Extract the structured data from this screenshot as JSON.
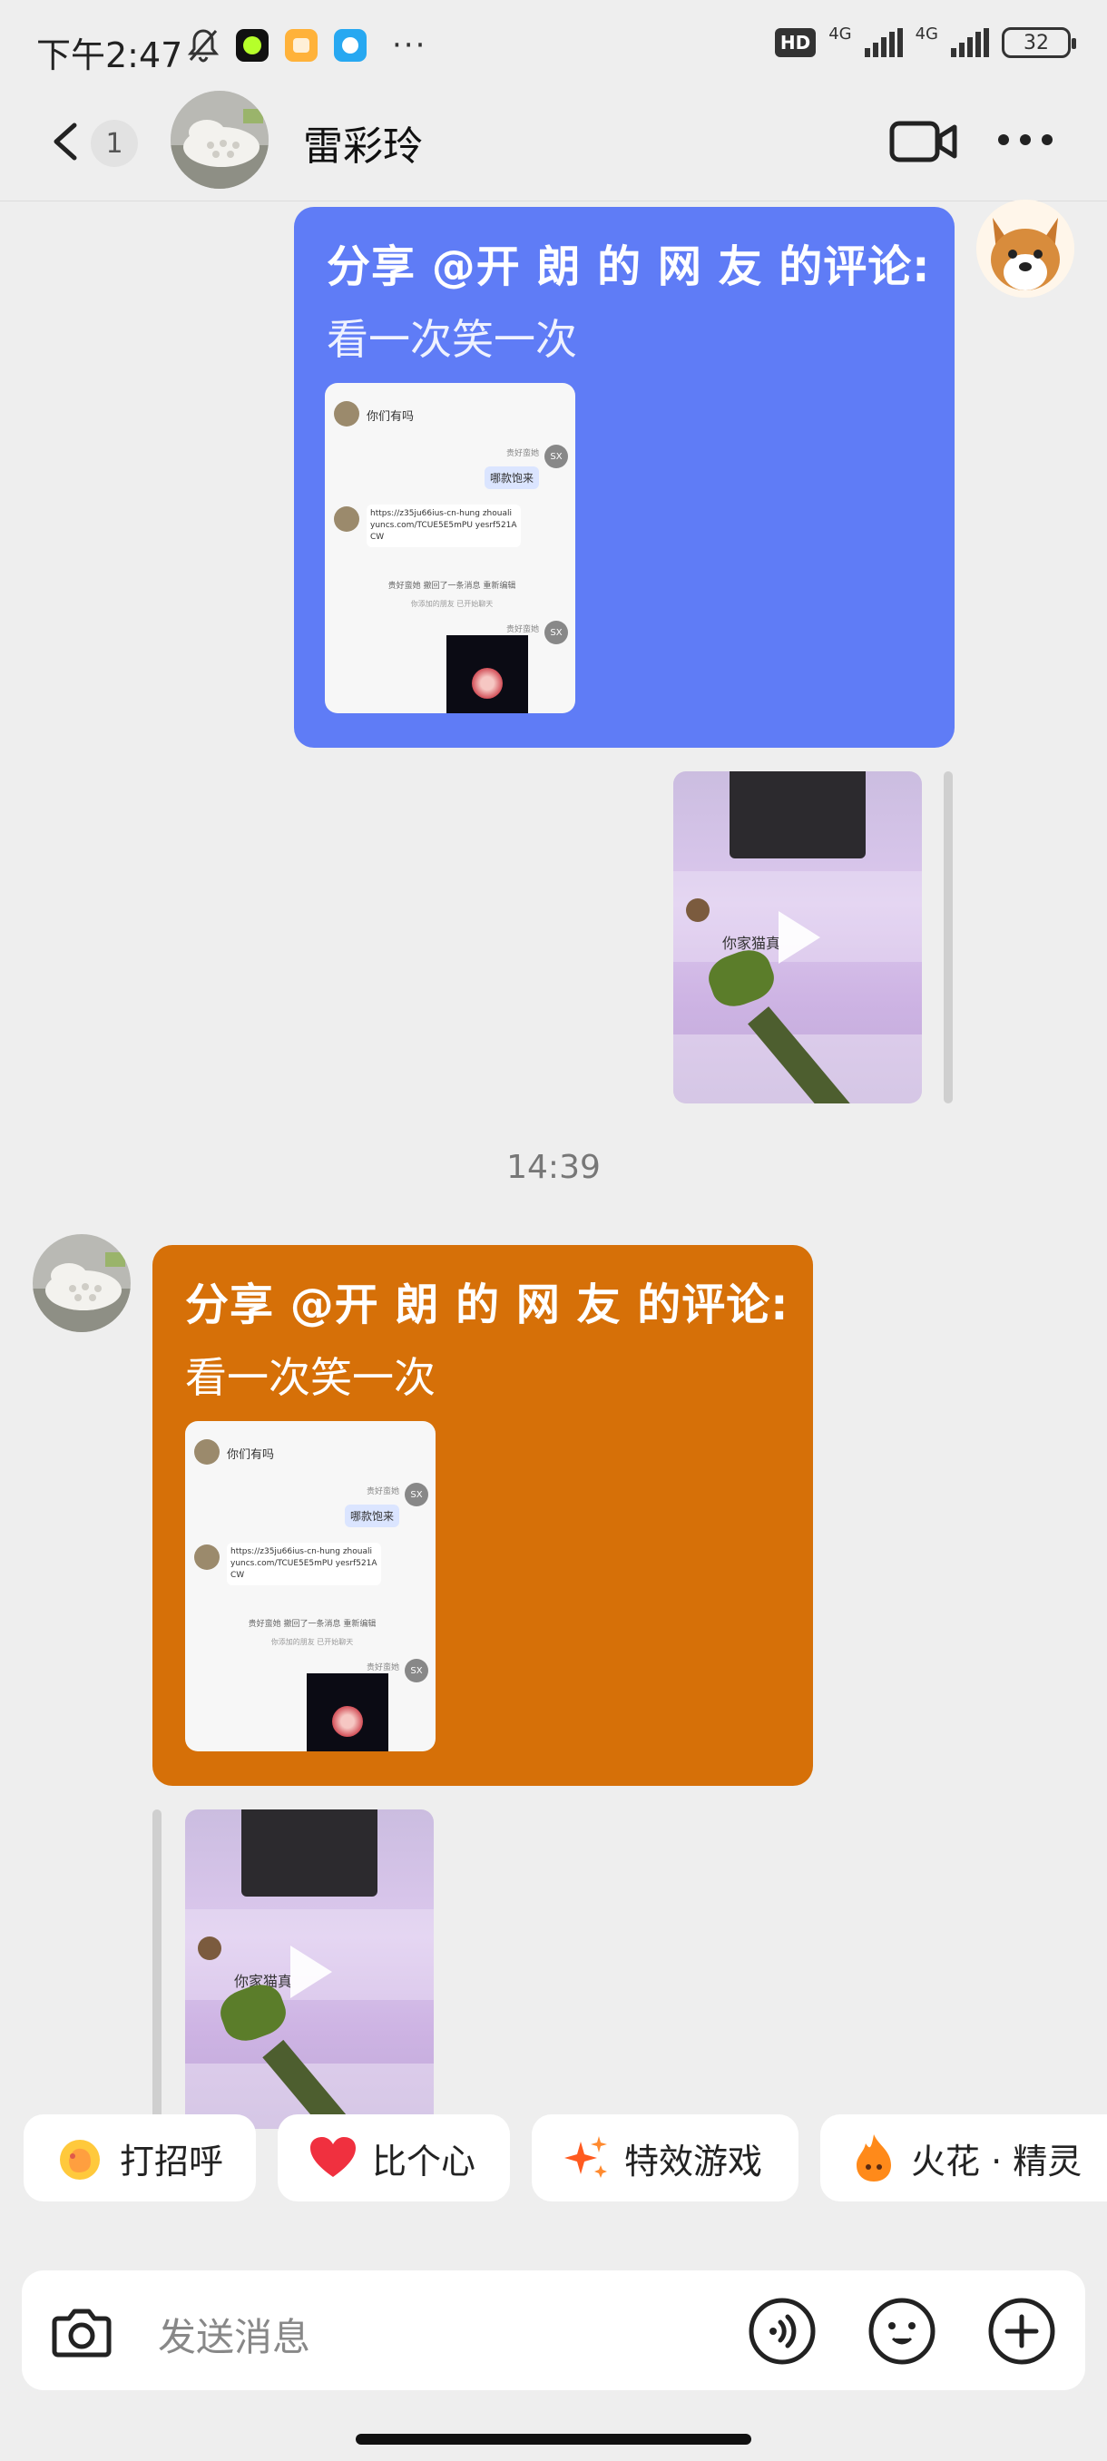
{
  "status_bar": {
    "time": "下午2:47",
    "hd": "HD",
    "network_1": "4G",
    "network_2": "4G",
    "battery": "32"
  },
  "header": {
    "back_label": "返回",
    "unread_count": "1",
    "contact_name": "雷彩玲"
  },
  "messages": [
    {
      "side": "right",
      "type": "share",
      "title": "分享 @开 朗 的 网 友 的评论:",
      "text": "看一次笑一次",
      "color": "#5f7cf6",
      "thumb": {
        "line1": "你们有吗",
        "line2": "哪款饱来",
        "link": "https://z35ju66ius-cn-hung zhouali yuncs.com/TCUE5E5mPU yesrf521ACW",
        "notice": "贵好蛮她 撤回了一条消息 重新编辑",
        "notice2": "你添加的朋友 已开始聊天",
        "sender": "贵好蛮她",
        "sticker": "SX"
      }
    },
    {
      "side": "right",
      "type": "video",
      "caption": "你家猫真"
    },
    {
      "type": "time",
      "text": "14:39"
    },
    {
      "side": "left",
      "type": "share",
      "title": "分享 @开 朗 的 网 友 的评论:",
      "text": "看一次笑一次",
      "color": "#d67008",
      "thumb": {
        "line1": "你们有吗",
        "line2": "哪款饱来",
        "link": "https://z35ju66ius-cn-hung zhouali yuncs.com/TCUE5E5mPU yesrf521ACW",
        "notice": "贵好蛮她 撤回了一条消息 重新编辑",
        "notice2": "你添加的朋友 已开始聊天",
        "sender": "贵好蛮她",
        "sticker": "SX"
      }
    },
    {
      "side": "left",
      "type": "video",
      "caption": "你家猫真"
    }
  ],
  "quick_actions": [
    {
      "label": "打招呼",
      "icon": "wave-hand-icon"
    },
    {
      "label": "比个心",
      "icon": "heart-icon"
    },
    {
      "label": "特效游戏",
      "icon": "sparkles-icon"
    },
    {
      "label": "火花 · 精灵",
      "icon": "flame-icon"
    }
  ],
  "input": {
    "placeholder": "发送消息"
  },
  "colors": {
    "sent_bubble": "#5f7cf6",
    "received_bubble": "#d67008",
    "background": "#eeeeee"
  }
}
